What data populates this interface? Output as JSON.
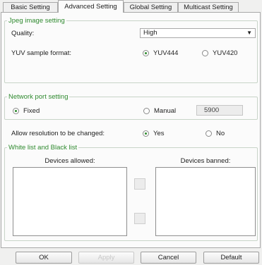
{
  "tabs": [
    {
      "label": "Basic Setting",
      "active": false
    },
    {
      "label": "Advanced Setting",
      "active": true
    },
    {
      "label": "Global Setting",
      "active": false
    },
    {
      "label": "Multicast Setting",
      "active": false
    }
  ],
  "jpeg": {
    "legend": "Jpeg image setting",
    "quality_label": "Quality:",
    "quality_value": "High",
    "yuv_label": "YUV sample format:",
    "yuv444": "YUV444",
    "yuv420": "YUV420",
    "yuv_selected": "YUV444"
  },
  "network": {
    "legend": "Network port setting",
    "fixed": "Fixed",
    "manual": "Manual",
    "port_value": "5900",
    "selected": "Fixed",
    "allow_resize_label": "Allow resolution to be changed:",
    "yes": "Yes",
    "no": "No",
    "allow_selected": "Yes"
  },
  "lists": {
    "legend": "White list and Black list",
    "allowed_label": "Devices allowed:",
    "banned_label": "Devices banned:"
  },
  "buttons": {
    "ok": "OK",
    "apply": "Apply",
    "cancel": "Cancel",
    "default": "Default"
  },
  "colors": {
    "accent_green": "#2f8a2f"
  }
}
